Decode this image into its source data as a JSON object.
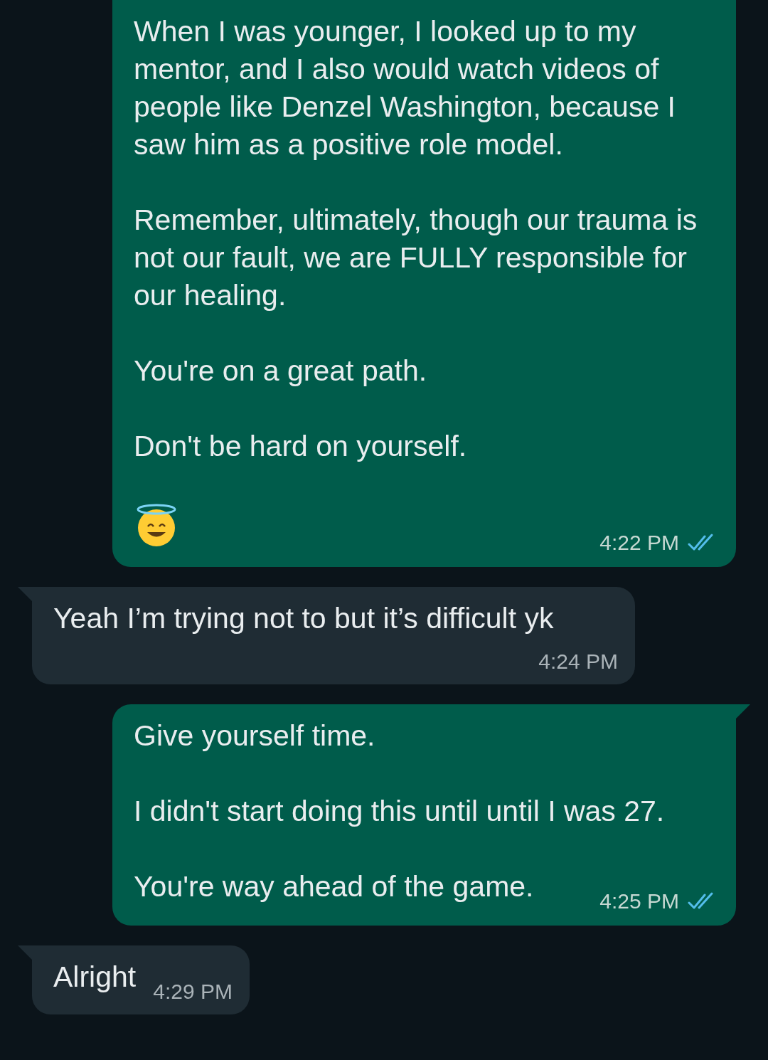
{
  "messages": [
    {
      "kind": "outgoing",
      "tail": false,
      "read": true,
      "time": "4:22 PM",
      "blocks": [
        {
          "kind": "text",
          "text": "When I was younger, I looked up to my mentor, and I also would watch videos of people like Denzel Washington, because I saw him as a positive role model."
        },
        {
          "kind": "text",
          "text": "Remember, ultimately, though our trauma is not our fault, we are FULLY responsible for our healing."
        },
        {
          "kind": "text",
          "text": "You're on a great path."
        },
        {
          "kind": "text",
          "text": "Don't be hard on yourself."
        },
        {
          "kind": "emoji"
        }
      ]
    },
    {
      "kind": "incoming",
      "tail": true,
      "time": "4:24 PM",
      "blocks": [
        {
          "kind": "text",
          "text": "Yeah I’m trying not to  but it’s difficult yk"
        }
      ]
    },
    {
      "kind": "outgoing",
      "tail": true,
      "read": true,
      "time": "4:25 PM",
      "blocks": [
        {
          "kind": "text",
          "text": "Give yourself time."
        },
        {
          "kind": "text",
          "text": "I didn't start doing this until until I was 27."
        },
        {
          "kind": "text",
          "text": "You're way ahead of the game."
        }
      ]
    },
    {
      "kind": "incoming",
      "tail": true,
      "time": "4:29 PM",
      "blocks": [
        {
          "kind": "text",
          "text": "Alright"
        }
      ]
    }
  ]
}
